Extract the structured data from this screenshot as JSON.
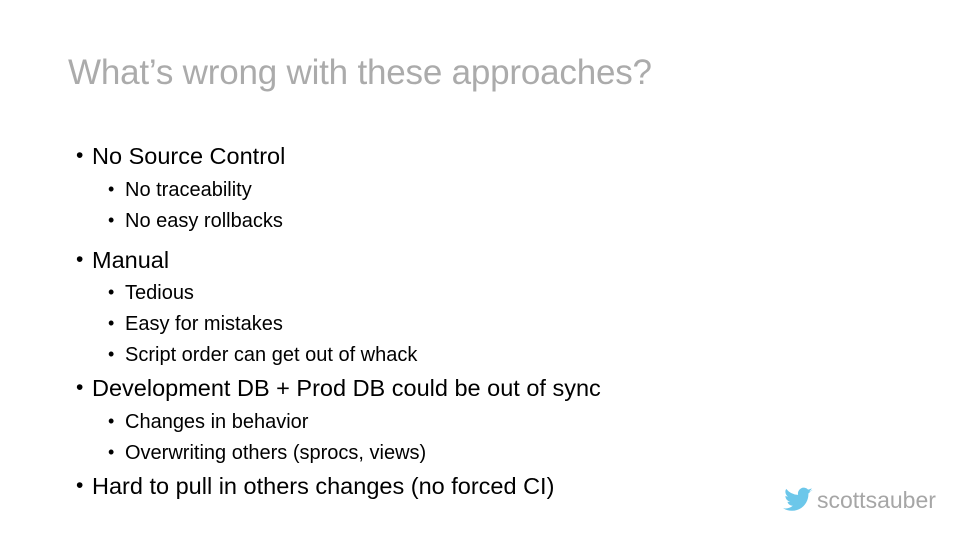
{
  "slide": {
    "title": "What’s wrong with these approaches?",
    "title_color": "#ababab",
    "background_color": "#ffffff",
    "bullets": [
      {
        "text": "No Source Control",
        "level": 1,
        "children": [
          {
            "text": "No traceability",
            "level": 2
          },
          {
            "text": "No easy rollbacks",
            "level": 2
          }
        ]
      },
      {
        "text": "Manual",
        "level": 1,
        "children": [
          {
            "text": "Tedious",
            "level": 2
          },
          {
            "text": "Easy for mistakes",
            "level": 2
          },
          {
            "text": "Script order can get out of whack",
            "level": 2
          }
        ]
      },
      {
        "text": "Development DB + Prod DB could be out of sync",
        "level": 1,
        "children": [
          {
            "text": "Changes in behavior",
            "level": 2
          },
          {
            "text": "Overwriting others (sprocs, views)",
            "level": 2
          }
        ]
      },
      {
        "text": "Hard to pull in others changes (no forced CI)",
        "level": 1,
        "children": []
      }
    ]
  },
  "footer": {
    "twitter_icon": "twitter-bird-icon",
    "twitter_icon_color": "#6cc7ea",
    "handle": "scottsauber",
    "handle_color": "#a6a6a6"
  }
}
